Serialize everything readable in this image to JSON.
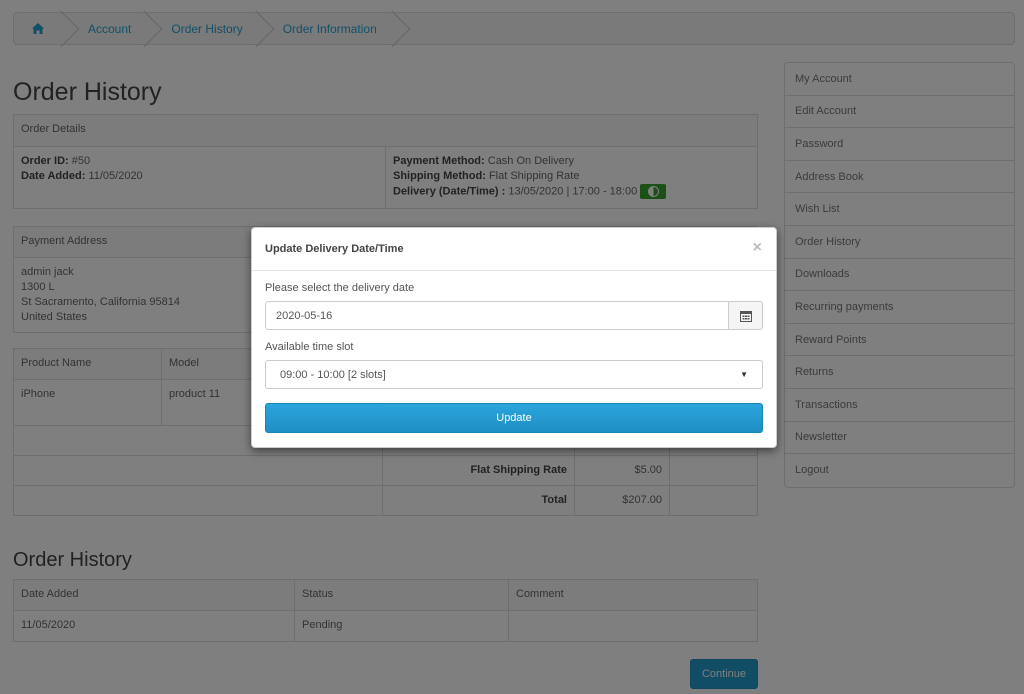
{
  "breadcrumb": {
    "home_icon": "home-icon",
    "items": [
      "Account",
      "Order History",
      "Order Information"
    ]
  },
  "page_title": "Order History",
  "order_details": {
    "header": "Order Details",
    "order_id_label": "Order ID:",
    "order_id": "#50",
    "date_added_label": "Date Added:",
    "date_added": "11/05/2020",
    "payment_method_label": "Payment Method:",
    "payment_method": "Cash On Delivery",
    "shipping_method_label": "Shipping Method:",
    "shipping_method": "Flat Shipping Rate",
    "delivery_label": "Delivery (Date/Time) :",
    "delivery": "13/05/2020 | 17:00 - 18:00",
    "toggle_color": "#37a32f"
  },
  "payment_address": {
    "header": "Payment Address",
    "lines": [
      "admin jack",
      "1300 L",
      "St Sacramento, California 95814",
      "United States"
    ]
  },
  "products": {
    "headers": [
      "Product Name",
      "Model"
    ],
    "rows": [
      [
        "iPhone",
        "product 11"
      ]
    ]
  },
  "totals": [
    {
      "label": "Flat Shipping Rate",
      "value": "$5.00"
    },
    {
      "label": "Total",
      "value": "$207.00"
    }
  ],
  "history": {
    "title": "Order History",
    "headers": [
      "Date Added",
      "Status",
      "Comment"
    ],
    "rows": [
      [
        "11/05/2020",
        "Pending",
        ""
      ]
    ]
  },
  "sidebar": {
    "items": [
      "My Account",
      "Edit Account",
      "Password",
      "Address Book",
      "Wish List",
      "Order History",
      "Downloads",
      "Recurring payments",
      "Reward Points",
      "Returns",
      "Transactions",
      "Newsletter",
      "Logout"
    ]
  },
  "continue_label": "Continue",
  "modal": {
    "title": "Update Delivery Date/Time",
    "close": "×",
    "date_label": "Please select the delivery date",
    "date_value": "2020-05-16",
    "slot_label": "Available time slot",
    "slot_value": "09:00 - 10:00 [2 slots]",
    "update_label": "Update",
    "accent": "#229ac8"
  }
}
